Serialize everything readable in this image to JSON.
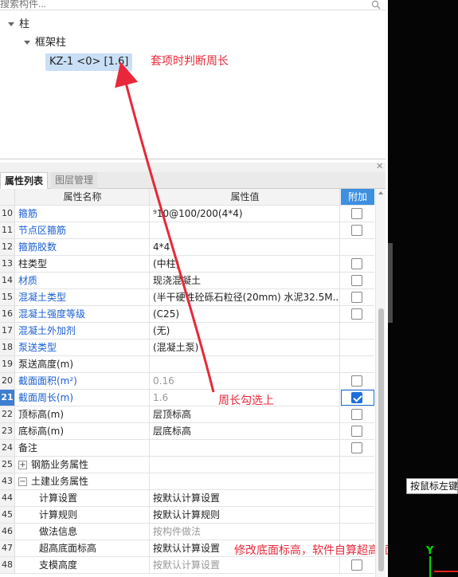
{
  "search": {
    "placeholder": "搜索构件..."
  },
  "tree": {
    "root": "柱",
    "child": "框架柱",
    "leaf": "KZ-1 <0> [1.6]"
  },
  "annotations": {
    "top": "套项时判断周长",
    "middle": "周长勾选上",
    "bottom": "修改底面标高，软件自算超高面积"
  },
  "tabs": [
    {
      "label": "属性列表",
      "active": true
    },
    {
      "label": "图层管理",
      "active": false
    }
  ],
  "grid": {
    "headers": {
      "name": "属性名称",
      "value": "属性值",
      "extra": "附加"
    },
    "rows": [
      {
        "num": "10",
        "name": "箍筋",
        "value": "⁹10@100/200(4*4)",
        "check": false
      },
      {
        "num": "11",
        "name": "节点区箍筋",
        "value": "",
        "check": false
      },
      {
        "num": "12",
        "name": "箍筋胶数",
        "value": "4*4",
        "check": null
      },
      {
        "num": "13",
        "name": "柱类型",
        "value": "(中柱)",
        "check": false
      },
      {
        "num": "14",
        "name": "材质",
        "value": "现浇混凝土",
        "check": false
      },
      {
        "num": "15",
        "name": "混凝土类型",
        "value": "(半干硬性砼砾石粒径(20mm) 水泥32.5M...",
        "check": false
      },
      {
        "num": "16",
        "name": "混凝土强度等级",
        "value": "(C25)",
        "check": false
      },
      {
        "num": "17",
        "name": "混凝土外加剂",
        "value": "(无)",
        "check": null
      },
      {
        "num": "18",
        "name": "泵送类型",
        "value": "(混凝土泵)",
        "check": null
      },
      {
        "num": "19",
        "name": "泵送高度(m)",
        "value": "",
        "check": null
      },
      {
        "num": "20",
        "name": "截面面积(m²)",
        "value": "0.16",
        "check": false
      },
      {
        "num": "21",
        "name": "截面周长(m)",
        "value": "1.6",
        "check": true
      },
      {
        "num": "22",
        "name": "顶标高(m)",
        "value": "层顶标高",
        "check": false
      },
      {
        "num": "23",
        "name": "底标高(m)",
        "value": "层底标高",
        "check": false
      },
      {
        "num": "24",
        "name": "备注",
        "value": "",
        "check": false
      },
      {
        "num": "25",
        "name": "钢筋业务属性",
        "value": "",
        "check": null
      },
      {
        "num": "43",
        "name": "土建业务属性",
        "value": "",
        "check": null
      },
      {
        "num": "44",
        "name": "计算设置",
        "value": "按默认计算设置",
        "check": null
      },
      {
        "num": "45",
        "name": "计算规则",
        "value": "按默认计算规则",
        "check": null
      },
      {
        "num": "46",
        "name": "做法信息",
        "value": "按构件做法",
        "check": null
      },
      {
        "num": "47",
        "name": "超高底面标高",
        "value": "按默认计算设置",
        "check": null
      },
      {
        "num": "48",
        "name": "支模高度",
        "value": "按默认计算设置",
        "check": false
      }
    ]
  },
  "statusbar": {
    "tip": "按鼠标左键"
  },
  "axis": {
    "y_label": "Y"
  }
}
